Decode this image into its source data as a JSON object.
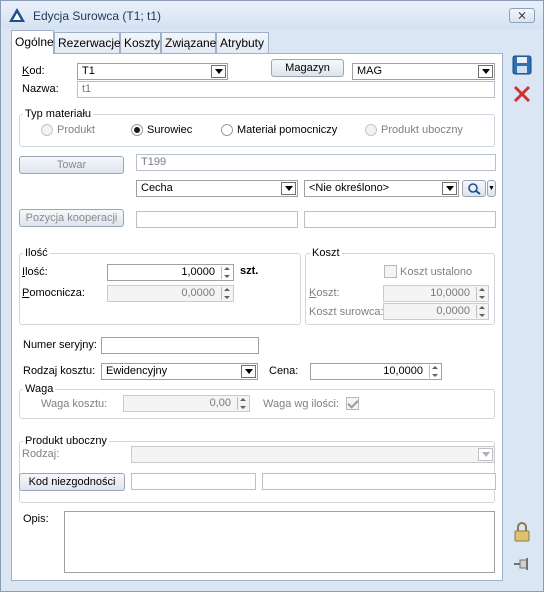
{
  "window": {
    "title": "Edycja Surowca (T1; t1)",
    "close_glyph": "⨯"
  },
  "tabs": [
    {
      "label": "Ogólne"
    },
    {
      "label": "Rezerwacje"
    },
    {
      "label": "Koszty"
    },
    {
      "label": "Związane"
    },
    {
      "label": "Atrybuty"
    }
  ],
  "kod": {
    "label": "Kod:",
    "value": "T1"
  },
  "magazyn": {
    "button": "Magazyn",
    "value": "MAG"
  },
  "nazwa": {
    "label": "Nazwa:",
    "value": "t1"
  },
  "typ": {
    "title": "Typ materiału",
    "options": [
      "Produkt",
      "Surowiec",
      "Materiał pomocniczy",
      "Produkt uboczny"
    ],
    "selected": "Surowiec"
  },
  "towar": {
    "button": "Towar",
    "value": "T199"
  },
  "cecha": {
    "value": "Cecha",
    "select": "<Nie określono>"
  },
  "pozycja": {
    "button": "Pozycja kooperacji"
  },
  "ilosc": {
    "title": "Ilość",
    "ilosc_label": "Ilość:",
    "ilosc_value": "1,0000",
    "unit": "szt.",
    "pom_label": "Pomocnicza:",
    "pom_value": "0,0000"
  },
  "koszt": {
    "title": "Koszt",
    "ustalono_label": "Koszt ustalono",
    "ustalono_checked": false,
    "koszt_label": "Koszt:",
    "koszt_value": "10,0000",
    "surowca_label": "Koszt surowca:",
    "surowca_value": "0,0000"
  },
  "numer": {
    "label": "Numer seryjny:",
    "value": ""
  },
  "rodzaj_kosztu": {
    "label": "Rodzaj kosztu:",
    "value": "Ewidencyjny"
  },
  "cena": {
    "label": "Cena:",
    "value": "10,0000"
  },
  "waga": {
    "title": "Waga",
    "kosztu_label": "Waga kosztu:",
    "kosztu_value": "0,00",
    "wg_label": "Waga wg ilości:",
    "wg_checked": true
  },
  "uboczny": {
    "title": "Produkt uboczny",
    "rodzaj_label": "Rodzaj:",
    "rodzaj_value": "",
    "kod_button": "Kod niezgodności"
  },
  "opis": {
    "label": "Opis:",
    "value": ""
  },
  "colors": {
    "accent": "#1e395b",
    "save": "#2e6fb7",
    "cancel": "#d03030"
  }
}
